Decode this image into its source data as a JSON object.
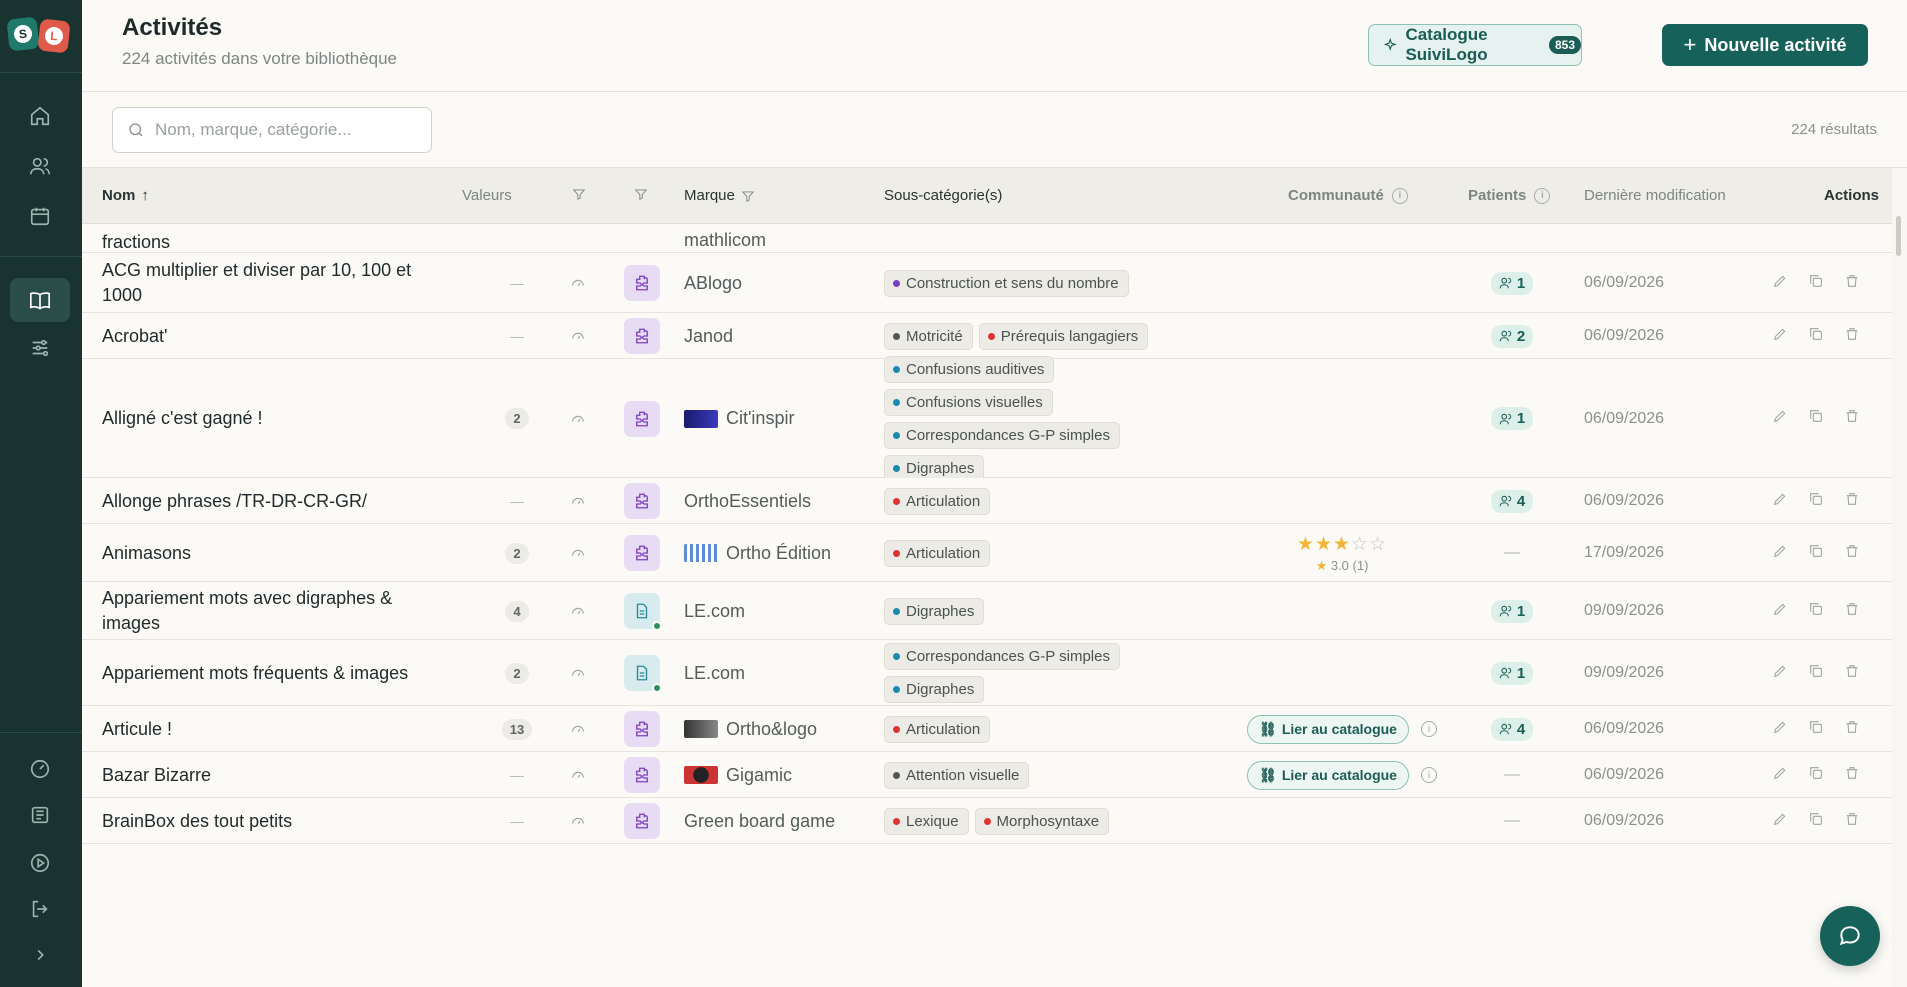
{
  "header": {
    "title": "Activités",
    "subtitle": "224 activités dans votre bibliothèque",
    "catalog_label": "Catalogue SuiviLogo",
    "catalog_count": "853",
    "new_label": "Nouvelle activité"
  },
  "search": {
    "placeholder": "Nom, marque, catégorie...",
    "results": "224 résultats"
  },
  "sidebar": {
    "logo_left": "S",
    "logo_right": "L"
  },
  "columns": {
    "nom": "Nom",
    "valeurs": "Valeurs",
    "marque": "Marque",
    "souscat": "Sous-catégorie(s)",
    "communaute": "Communauté",
    "patients": "Patients",
    "modif": "Dernière modification",
    "actions": "Actions"
  },
  "partial_row": {
    "name": "fractions",
    "brand": "mathlicom"
  },
  "rows": [
    {
      "name": "ACG multiplier et diviser par 10, 100 et 1000",
      "valeurs": "—",
      "type": "game",
      "brand": "ABlogo",
      "tags": [
        [
          {
            "label": "Construction et sens du nombre",
            "color": "#7b3fc4"
          }
        ]
      ],
      "community": "",
      "patients": "1",
      "date": "06/09/2026"
    },
    {
      "name": "Acrobat'",
      "valeurs": "—",
      "type": "game",
      "brand": "Janod",
      "tags": [
        [
          {
            "label": "Motricité",
            "color": "#555"
          },
          {
            "label": "Prérequis langagiers",
            "color": "#d33"
          }
        ]
      ],
      "community": "",
      "patients": "2",
      "date": "06/09/2026"
    },
    {
      "name": "Alligné c'est gagné !",
      "valeurs": "2",
      "type": "game",
      "brand": "Cit'inspir",
      "tags": [
        [
          {
            "label": "Confusions auditives",
            "color": "#1a8ab0"
          }
        ],
        [
          {
            "label": "Confusions visuelles",
            "color": "#1a8ab0"
          }
        ],
        [
          {
            "label": "Correspondances G-P simples",
            "color": "#1a8ab0"
          }
        ],
        [
          {
            "label": "Digraphes",
            "color": "#1a8ab0"
          }
        ]
      ],
      "community": "",
      "patients": "1",
      "date": "06/09/2026"
    },
    {
      "name": "Allonge phrases /TR-DR-CR-GR/",
      "valeurs": "—",
      "type": "game",
      "brand": "OrthoEssentiels",
      "tags": [
        [
          {
            "label": "Articulation",
            "color": "#d33"
          }
        ]
      ],
      "community": "",
      "patients": "4",
      "date": "06/09/2026"
    },
    {
      "name": "Animasons",
      "valeurs": "2",
      "type": "game",
      "brand": "Ortho Édition",
      "tags": [
        [
          {
            "label": "Articulation",
            "color": "#d33"
          }
        ]
      ],
      "community": "stars",
      "rating": "3.0",
      "rating_count": "(1)",
      "patients": "",
      "date": "17/09/2026"
    },
    {
      "name": "Appariement mots avec digraphes & images",
      "valeurs": "4",
      "type": "doc",
      "brand": "LE.com",
      "tags": [
        [
          {
            "label": "Digraphes",
            "color": "#1a8ab0"
          }
        ]
      ],
      "community": "",
      "patients": "1",
      "date": "09/09/2026"
    },
    {
      "name": "Appariement mots fréquents & images",
      "valeurs": "2",
      "type": "doc",
      "brand": "LE.com",
      "tags": [
        [
          {
            "label": "Correspondances G-P simples",
            "color": "#1a8ab0"
          }
        ],
        [
          {
            "label": "Digraphes",
            "color": "#1a8ab0"
          }
        ]
      ],
      "community": "",
      "patients": "1",
      "date": "09/09/2026"
    },
    {
      "name": "Articule !",
      "valeurs": "13",
      "type": "game",
      "brand": "Ortho&logo",
      "tags": [
        [
          {
            "label": "Articulation",
            "color": "#d33"
          }
        ]
      ],
      "community": "link",
      "patients": "4",
      "date": "06/09/2026"
    },
    {
      "name": "Bazar Bizarre",
      "valeurs": "—",
      "type": "game",
      "brand": "Gigamic",
      "tags": [
        [
          {
            "label": "Attention visuelle",
            "color": "#555"
          }
        ]
      ],
      "community": "link",
      "patients": "",
      "date": "06/09/2026"
    },
    {
      "name": "BrainBox des tout petits",
      "valeurs": "—",
      "type": "game",
      "brand": "Green board game",
      "tags": [
        [
          {
            "label": "Lexique",
            "color": "#d33"
          },
          {
            "label": "Morphosyntaxe",
            "color": "#d33"
          }
        ]
      ],
      "community": "",
      "patients": "",
      "date": "06/09/2026"
    }
  ],
  "link_label": "Lier au catalogue",
  "empty_dash": "—",
  "colors": {
    "brand": "#16625a",
    "sidebar": "#183330",
    "game_icon": "#7b3fc4",
    "doc_icon": "#2a8a98"
  }
}
